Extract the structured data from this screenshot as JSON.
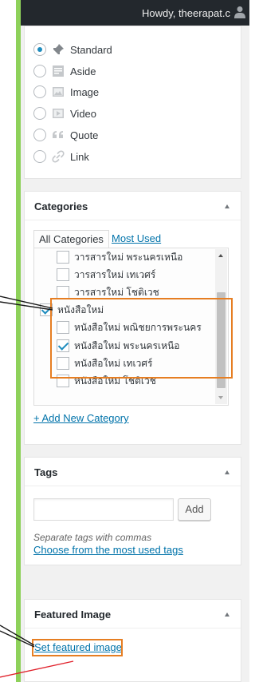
{
  "admin_bar": {
    "greeting": "Howdy, theerapat.c",
    "avatar_icon": "user-icon"
  },
  "post_format": {
    "options": [
      {
        "label": "Standard",
        "icon": "pin-icon",
        "checked": true
      },
      {
        "label": "Aside",
        "icon": "aside-icon",
        "checked": false
      },
      {
        "label": "Image",
        "icon": "image-icon",
        "checked": false
      },
      {
        "label": "Video",
        "icon": "video-icon",
        "checked": false
      },
      {
        "label": "Quote",
        "icon": "quote-icon",
        "checked": false
      },
      {
        "label": "Link",
        "icon": "link-icon",
        "checked": false
      }
    ]
  },
  "categories": {
    "title": "Categories",
    "tab_all": "All Categories",
    "tab_most_used": "Most Used",
    "items": [
      {
        "label": "วารสารใหม่ พระนครเหนือ",
        "checked": false
      },
      {
        "label": "วารสารใหม่ เทเวศร์",
        "checked": false
      },
      {
        "label": "วารสารใหม่ โชติเวช",
        "checked": false
      },
      {
        "label": "หนังสือใหม่",
        "checked": true
      },
      {
        "label": "หนังสือใหม่ พณิชยการพระนคร",
        "checked": false
      },
      {
        "label": "หนังสือใหม่ พระนครเหนือ",
        "checked": true
      },
      {
        "label": "หนังสือใหม่ เทเวศร์",
        "checked": false
      },
      {
        "label": "หนังสือใหม่ โชติเวช",
        "checked": false
      }
    ],
    "add_new_link": "+ Add New Category"
  },
  "tags": {
    "title": "Tags",
    "input_value": "",
    "add_button": "Add",
    "hint": "Separate tags with commas",
    "choose_link": "Choose from the most used tags"
  },
  "featured_image": {
    "title": "Featured Image",
    "set_link": "Set featured image"
  },
  "colors": {
    "frame": "#8ed15a",
    "highlight": "#e67e22",
    "link": "#0073aa",
    "admin_bar": "#23282d",
    "arrow_red": "#e0202a"
  }
}
